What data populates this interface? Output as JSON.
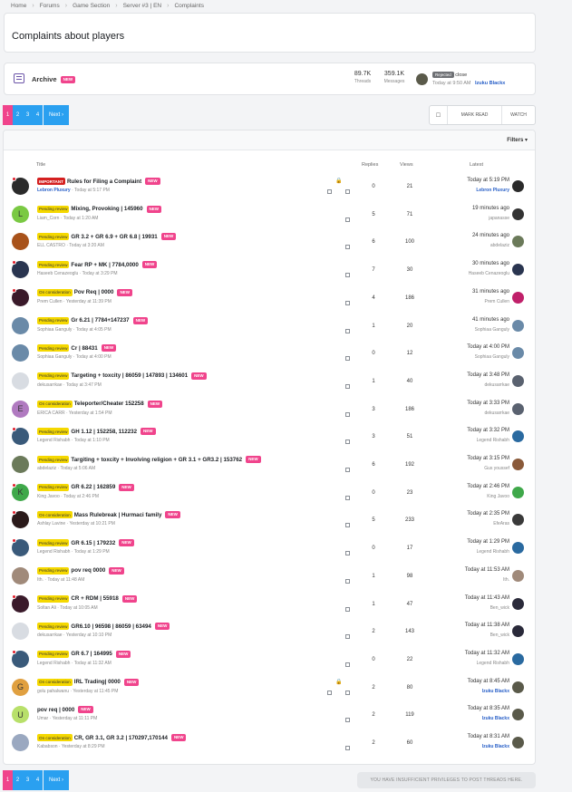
{
  "breadcrumb": [
    "Home",
    "Forums",
    "Game Section",
    "Server #3 | EN",
    "Complaints"
  ],
  "page_title": "Complaints about players",
  "archive": {
    "title": "Archive",
    "new_badge": "NEW",
    "threads_value": "89.7K",
    "threads_label": "Threads",
    "messages_value": "359.1K",
    "messages_label": "Messages",
    "last_prefix": "Rejected",
    "last_title": "close",
    "last_time": "Today at 9:50 AM",
    "last_user": "Izuku Blackx"
  },
  "pagination": {
    "pages": [
      "1",
      "2",
      "3",
      "4"
    ],
    "next": "Next ›"
  },
  "actions": {
    "mark_read": "MARK READ",
    "watch": "WATCH"
  },
  "filters": "Filters",
  "columns": {
    "title": "Title",
    "replies": "Replies",
    "views": "Views",
    "latest": "Latest"
  },
  "new_label": "NEW",
  "threads": [
    {
      "prefix": "IMPORTANT",
      "ptype": "important",
      "title": "Rules for Filing a Complaint",
      "author": "Lebron Pluxury",
      "started": "Today at 5:17 PM",
      "replies": "0",
      "views": "21",
      "latest_time": "Today at 5:19 PM",
      "latest_user": "Lebron Pluxury",
      "letter": "",
      "avatar_color": "#2b2b2b",
      "latest_color": "#2b2b2b",
      "dot": true,
      "lock": true,
      "latest_blue": true
    },
    {
      "prefix": "Pending review",
      "ptype": "pending",
      "title": "Mixing, Provoking | 145960",
      "author": "Liam_Corn",
      "started": "Today at 1:20 AM",
      "replies": "5",
      "views": "71",
      "latest_time": "19 minutes ago",
      "latest_user": "japanasse",
      "letter": "L",
      "avatar_color": "#7ac943",
      "latest_color": "#333"
    },
    {
      "prefix": "Pending review",
      "ptype": "pending",
      "title": "GR 3.2 + GR 6.9 + GR 6.8 | 19931",
      "author": "ELL CASTRO",
      "started": "Today at 3:20 AM",
      "replies": "6",
      "views": "100",
      "latest_time": "24 minutes ago",
      "latest_user": "abdelaziz",
      "letter": "",
      "avatar_color": "#a8521a",
      "latest_color": "#6b7a5a"
    },
    {
      "prefix": "Pending review",
      "ptype": "pending",
      "title": "Fear RP + MK | 7784,0000",
      "author": "Haseeb Cenazeoglu",
      "started": "Today at 3:29 PM",
      "replies": "7",
      "views": "30",
      "latest_time": "30 minutes ago",
      "latest_user": "Haseeb Cenazeoglu",
      "letter": "",
      "avatar_color": "#2a3550",
      "latest_color": "#2a3550",
      "dot": true
    },
    {
      "prefix": "On consideration",
      "ptype": "consider",
      "title": "Pov Req | 0000",
      "author": "Prem Cullen",
      "started": "Yesterday at 11:39 PM",
      "replies": "4",
      "views": "186",
      "latest_time": "31 minutes ago",
      "latest_user": "Prem Cullen",
      "letter": "",
      "avatar_color": "#3a1a2a",
      "latest_color": "#c0206a",
      "dot": true
    },
    {
      "prefix": "Pending review",
      "ptype": "pending",
      "title": "Gr 6.21 | 7784+147237",
      "author": "Sophiaa Ganguly",
      "started": "Today at 4:05 PM",
      "replies": "1",
      "views": "20",
      "latest_time": "41 minutes ago",
      "latest_user": "Sophiaa Ganguly",
      "letter": "",
      "avatar_color": "#6a8aa8",
      "latest_color": "#6a8aa8"
    },
    {
      "prefix": "Pending review",
      "ptype": "pending",
      "title": "Cr | 88431",
      "author": "Sophiaa Ganguly",
      "started": "Today at 4:00 PM",
      "replies": "0",
      "views": "12",
      "latest_time": "Today at 4:00 PM",
      "latest_user": "Sophiaa Ganguly",
      "letter": "",
      "avatar_color": "#6a8aa8",
      "latest_color": "#6a8aa8"
    },
    {
      "prefix": "Pending review",
      "ptype": "pending",
      "title": "Targeting + toxcity | 86059 | 147893 | 134601",
      "author": "dekusarrkae",
      "started": "Today at 3:47 PM",
      "replies": "1",
      "views": "40",
      "latest_time": "Today at 3:48 PM",
      "latest_user": "dekusarrkae",
      "letter": "",
      "avatar_color": "#d8dce2",
      "latest_color": "#5a6270"
    },
    {
      "prefix": "On consideration",
      "ptype": "consider",
      "title": "Teleporter/Cheater 152258",
      "author": "ERICA CARR",
      "started": "Yesterday at 1:54 PM",
      "replies": "3",
      "views": "186",
      "latest_time": "Today at 3:33 PM",
      "latest_user": "dekusarrkae",
      "letter": "E",
      "avatar_color": "#b07ac0",
      "latest_color": "#5a6270"
    },
    {
      "prefix": "Pending review",
      "ptype": "pending",
      "title": "GH 1.12 | 152258, 112232",
      "author": "Legend Rishabh",
      "started": "Today at 1:10 PM",
      "replies": "3",
      "views": "51",
      "latest_time": "Today at 3:32 PM",
      "latest_user": "Legend Rishabh",
      "letter": "",
      "avatar_color": "#3a5a7a",
      "latest_color": "#2a6aa0",
      "dot": true
    },
    {
      "prefix": "Pending review",
      "ptype": "pending",
      "title": "Targiting + toxcity + Involving religion + GR 3.1 + GR3.2 | 153762",
      "author": "abdelaziz",
      "started": "Today at 5:06 AM",
      "replies": "6",
      "views": "192",
      "latest_time": "Today at 3:15 PM",
      "latest_user": "Gus youssef",
      "letter": "",
      "avatar_color": "#6b7a5a",
      "latest_color": "#8a5a3a"
    },
    {
      "prefix": "Pending review",
      "ptype": "pending",
      "title": "GR 6.22 | 162859",
      "author": "King Javoo",
      "started": "Today at 2:46 PM",
      "replies": "0",
      "views": "23",
      "latest_time": "Today at 2:46 PM",
      "latest_user": "King Javoo",
      "letter": "K",
      "avatar_color": "#3fa84a",
      "latest_color": "#3fa84a",
      "dot": true
    },
    {
      "prefix": "On consideration",
      "ptype": "consider",
      "title": "Mass Rulebreak | Hurmaci family",
      "author": "Ashlay Lavine",
      "started": "Yesterday at 10:21 PM",
      "replies": "5",
      "views": "233",
      "latest_time": "Today at 2:35 PM",
      "latest_user": "EfeAras",
      "letter": "",
      "avatar_color": "#2b1a1a",
      "latest_color": "#3a3a3a",
      "dot": true
    },
    {
      "prefix": "Pending review",
      "ptype": "pending",
      "title": "GR 6.15 | 179232",
      "author": "Legend Rishabh",
      "started": "Today at 1:29 PM",
      "replies": "0",
      "views": "17",
      "latest_time": "Today at 1:29 PM",
      "latest_user": "Legend Rishabh",
      "letter": "",
      "avatar_color": "#3a5a7a",
      "latest_color": "#2a6aa0",
      "dot": true
    },
    {
      "prefix": "Pending review",
      "ptype": "pending",
      "title": "pov req 0000",
      "author": "Ith.",
      "started": "Today at 11:48 AM",
      "replies": "1",
      "views": "98",
      "latest_time": "Today at 11:53 AM",
      "latest_user": "Ith.",
      "letter": "",
      "avatar_color": "#a08a7a",
      "latest_color": "#a08a7a"
    },
    {
      "prefix": "Pending review",
      "ptype": "pending",
      "title": "CR + RDM | 55918",
      "author": "Soltan Ali",
      "started": "Today at 10:05 AM",
      "replies": "1",
      "views": "47",
      "latest_time": "Today at 11:43 AM",
      "latest_user": "Ben_wick",
      "letter": "",
      "avatar_color": "#3a1a2a",
      "latest_color": "#2a2a3a",
      "dot": true
    },
    {
      "prefix": "Pending review",
      "ptype": "pending",
      "title": "GR6.10 | 96598 | 86059 | 63494",
      "author": "dekusarrkae",
      "started": "Yesterday at 10:10 PM",
      "replies": "2",
      "views": "143",
      "latest_time": "Today at 11:38 AM",
      "latest_user": "Ben_wick",
      "letter": "",
      "avatar_color": "#d8dce2",
      "latest_color": "#2a2a3a"
    },
    {
      "prefix": "Pending review",
      "ptype": "pending",
      "title": "GR 6.7 | 164995",
      "author": "Legend Rishabh",
      "started": "Today at 11:32 AM",
      "replies": "0",
      "views": "22",
      "latest_time": "Today at 11:32 AM",
      "latest_user": "Legend Rishabh",
      "letter": "",
      "avatar_color": "#3a5a7a",
      "latest_color": "#2a6aa0",
      "dot": true
    },
    {
      "prefix": "On consideration",
      "ptype": "consider",
      "title": "IRL Trading| 0000",
      "author": "golu pahalwanu",
      "started": "Yesterday at 11:45 PM",
      "replies": "2",
      "views": "80",
      "latest_time": "Today at 8:45 AM",
      "latest_user": "Izuku Blackx",
      "letter": "G",
      "avatar_color": "#e0a040",
      "latest_color": "#5a5a4a",
      "lock": true,
      "latest_blue": true
    },
    {
      "prefix": "",
      "ptype": "none",
      "title": "pov req | 0000",
      "author": "Umar",
      "started": "Yesterday at 11:11 PM",
      "replies": "2",
      "views": "119",
      "latest_time": "Today at 8:35 AM",
      "latest_user": "Izuku Blackx",
      "letter": "U",
      "avatar_color": "#b8e06a",
      "latest_color": "#5a5a4a",
      "latest_blue": true
    },
    {
      "prefix": "On consideration",
      "ptype": "consider",
      "title": "CR, GR 3.1, GR 3.2 | 170297,170144",
      "author": "Kababson",
      "started": "Yesterday at 8:29 PM",
      "replies": "2",
      "views": "60",
      "latest_time": "Today at 8:31 AM",
      "latest_user": "Izuku Blackx",
      "letter": "",
      "avatar_color": "#9aa8c0",
      "latest_color": "#5a5a4a",
      "latest_blue": true
    }
  ],
  "insufficient": "YOU HAVE INSUFFICIENT PRIVILEGES TO POST THREADS HERE."
}
